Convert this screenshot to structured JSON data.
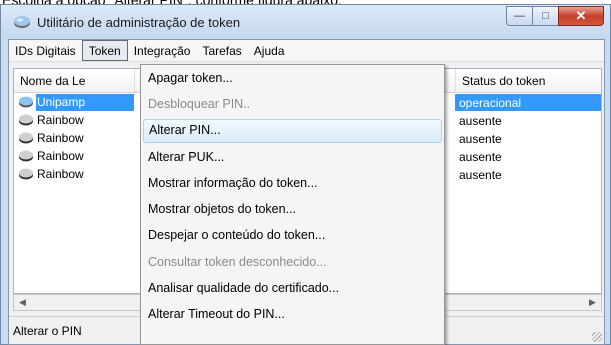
{
  "caption": "Escolha a opção \"Alterar PIN\", conforme figura abaixo;",
  "window": {
    "title": "Utilitário de administração de token",
    "buttons": {
      "minimize": "—",
      "maximize": "□",
      "close": "✕"
    }
  },
  "menubar": [
    {
      "label": "IDs Digitais",
      "active": false
    },
    {
      "label": "Token",
      "active": true
    },
    {
      "label": "Integração",
      "active": false
    },
    {
      "label": "Tarefas",
      "active": false
    },
    {
      "label": "Ajuda",
      "active": false
    }
  ],
  "table": {
    "columns": [
      "Nome da Le",
      "",
      "Status do token"
    ],
    "rows": [
      {
        "name": "Unipamp",
        "status": "operacional",
        "selected": true
      },
      {
        "name": "Rainbow",
        "status": "ausente",
        "selected": false
      },
      {
        "name": "Rainbow",
        "status": "ausente",
        "selected": false
      },
      {
        "name": "Rainbow",
        "status": "ausente",
        "selected": false
      },
      {
        "name": "Rainbow",
        "status": "ausente",
        "selected": false
      }
    ]
  },
  "statusbar": {
    "text": "Alterar o PIN"
  },
  "token_menu": {
    "items": [
      {
        "label": "Apagar token...",
        "disabled": false,
        "hover": false
      },
      {
        "label": "Desbloquear PIN..",
        "disabled": true,
        "hover": false
      },
      {
        "label": "Alterar PIN...",
        "disabled": false,
        "hover": true
      },
      {
        "label": "Alterar PUK...",
        "disabled": false,
        "hover": false
      },
      {
        "label": "Mostrar informação do token...",
        "disabled": false,
        "hover": false
      },
      {
        "label": "Mostrar objetos do token...",
        "disabled": false,
        "hover": false
      },
      {
        "label": "Despejar o conteúdo do token...",
        "disabled": false,
        "hover": false
      },
      {
        "label": "Consultar token desconhecido...",
        "disabled": true,
        "hover": false
      },
      {
        "label": "Analisar qualidade do certificado...",
        "disabled": false,
        "hover": false
      },
      {
        "label": "Alterar Timeout do PIN...",
        "disabled": false,
        "hover": false
      }
    ]
  },
  "colors": {
    "selection": "#3399ff",
    "hover_border": "#a8d8f0",
    "disabled_text": "#8a8a8a"
  }
}
